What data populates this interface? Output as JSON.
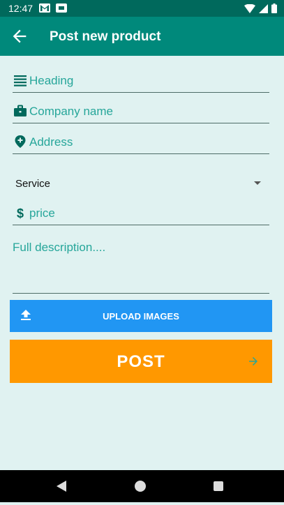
{
  "status_bar": {
    "time": "12:47",
    "icons": [
      "gmail-icon",
      "message-icon",
      "wifi-icon",
      "signal-icon",
      "battery-icon"
    ]
  },
  "app_bar": {
    "title": "Post new product",
    "back_icon": "arrow-back-icon",
    "color": "#00897b"
  },
  "form": {
    "heading": {
      "placeholder": "Heading",
      "icon": "lines-icon"
    },
    "company": {
      "placeholder": "Company name",
      "icon": "briefcase-icon"
    },
    "address": {
      "placeholder": "Address",
      "icon": "location-pin-icon"
    },
    "category": {
      "selected": "Service",
      "icon": "dropdown-arrow-icon"
    },
    "price": {
      "placeholder": "price",
      "icon": "dollar-icon"
    },
    "description": {
      "placeholder": "Full description...."
    }
  },
  "buttons": {
    "upload": {
      "label": "UPLOAD IMAGES",
      "icon": "upload-icon",
      "color": "#2196f3"
    },
    "post": {
      "label": "POST",
      "icon": "arrow-forward-icon",
      "color": "#ff9800"
    }
  },
  "colors": {
    "background": "#e0f2f1",
    "accent": "#26a69a",
    "status_bar": "#00695c"
  }
}
